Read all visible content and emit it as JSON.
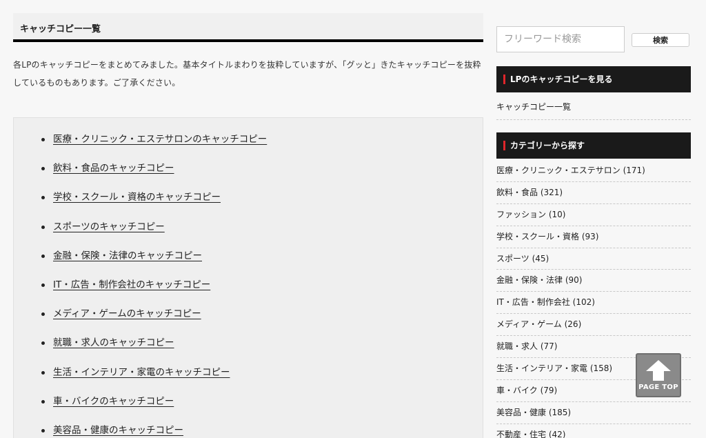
{
  "main": {
    "title": "キャッチコピー一覧",
    "intro": "各LPのキャッチコピーをまとめてみました。基本タイトルまわりを抜粋していますが、「グッと」きたキャッチコピーを抜粋しているものもあります。ご了承ください。",
    "list": [
      "医療・クリニック・エステサロンのキャッチコピー",
      "飲料・食品のキャッチコピー",
      "学校・スクール・資格のキャッチコピー",
      "スポーツのキャッチコピー",
      "金融・保険・法律のキャッチコピー",
      "IT・広告・制作会社のキャッチコピー",
      "メディア・ゲームのキャッチコピー",
      "就職・求人のキャッチコピー",
      "生活・インテリア・家電のキャッチコピー",
      "車・バイクのキャッチコピー",
      "美容品・健康のキャッチコピー"
    ]
  },
  "sidebar": {
    "search_placeholder": "フリーワード検索",
    "search_button": "検索",
    "widget1_title": "LPのキャッチコピーを見る",
    "widget1_link": "キャッチコピー一覧",
    "widget2_title": "カテゴリーから探す",
    "categories": [
      "医療・クリニック・エステサロン (171)",
      "飲料・食品 (321)",
      "ファッション (10)",
      "学校・スクール・資格 (93)",
      "スポーツ (45)",
      "金融・保険・法律 (90)",
      "IT・広告・制作会社 (102)",
      "メディア・ゲーム (26)",
      "就職・求人 (77)",
      "生活・インテリア・家電 (158)",
      "車・バイク (79)",
      "美容品・健康 (185)",
      "不動産・住宅 (42)"
    ]
  },
  "page_top": {
    "label": "PAGE TOP",
    "icon": "up-arrow-icon"
  },
  "colors": {
    "accent": "#e0262b",
    "widget_bg": "#1a1a1a"
  }
}
